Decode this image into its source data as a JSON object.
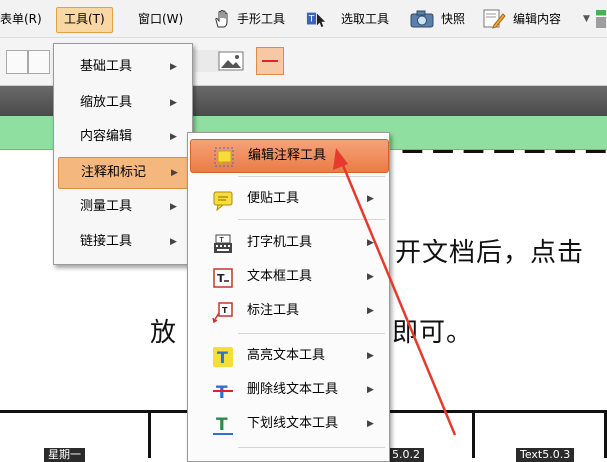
{
  "menubar": {
    "form_label": "表单(R)",
    "tools_label": "工具(T)",
    "window_label": "窗口(W)",
    "hand_tool_label": "手形工具",
    "select_tool_label": "选取工具",
    "snapshot_label": "快照",
    "edit_content_label": "编辑内容"
  },
  "document": {
    "line1": "开文档后，点击",
    "line2_prefix": "放",
    "line2_suffix": "即可。"
  },
  "table": {
    "cell1": "星期一",
    "cell3": "5.0.2",
    "cell4": "Text5.0.3"
  },
  "tools_menu": {
    "items": [
      {
        "label": "基础工具"
      },
      {
        "label": "缩放工具"
      },
      {
        "label": "内容编辑"
      },
      {
        "label": "注释和标记"
      },
      {
        "label": "测量工具"
      },
      {
        "label": "链接工具"
      }
    ]
  },
  "annotation_menu": {
    "items": [
      {
        "label": "编辑注释工具",
        "icon": "edit-annotation-icon"
      },
      {
        "label": "便贴工具",
        "icon": "sticky-note-icon"
      },
      {
        "label": "打字机工具",
        "icon": "typewriter-icon"
      },
      {
        "label": "文本框工具",
        "icon": "textbox-icon"
      },
      {
        "label": "标注工具",
        "icon": "callout-icon"
      },
      {
        "label": "高亮文本工具",
        "icon": "highlight-text-icon"
      },
      {
        "label": "删除线文本工具",
        "icon": "strikethrough-text-icon"
      },
      {
        "label": "下划线文本工具",
        "icon": "underline-text-icon"
      }
    ]
  },
  "colors": {
    "menu_highlight": "#f4b77d",
    "submenu_highlight": "#ea7c45",
    "green_strip": "#8fe0a0",
    "arrow": "#e53a2c"
  }
}
